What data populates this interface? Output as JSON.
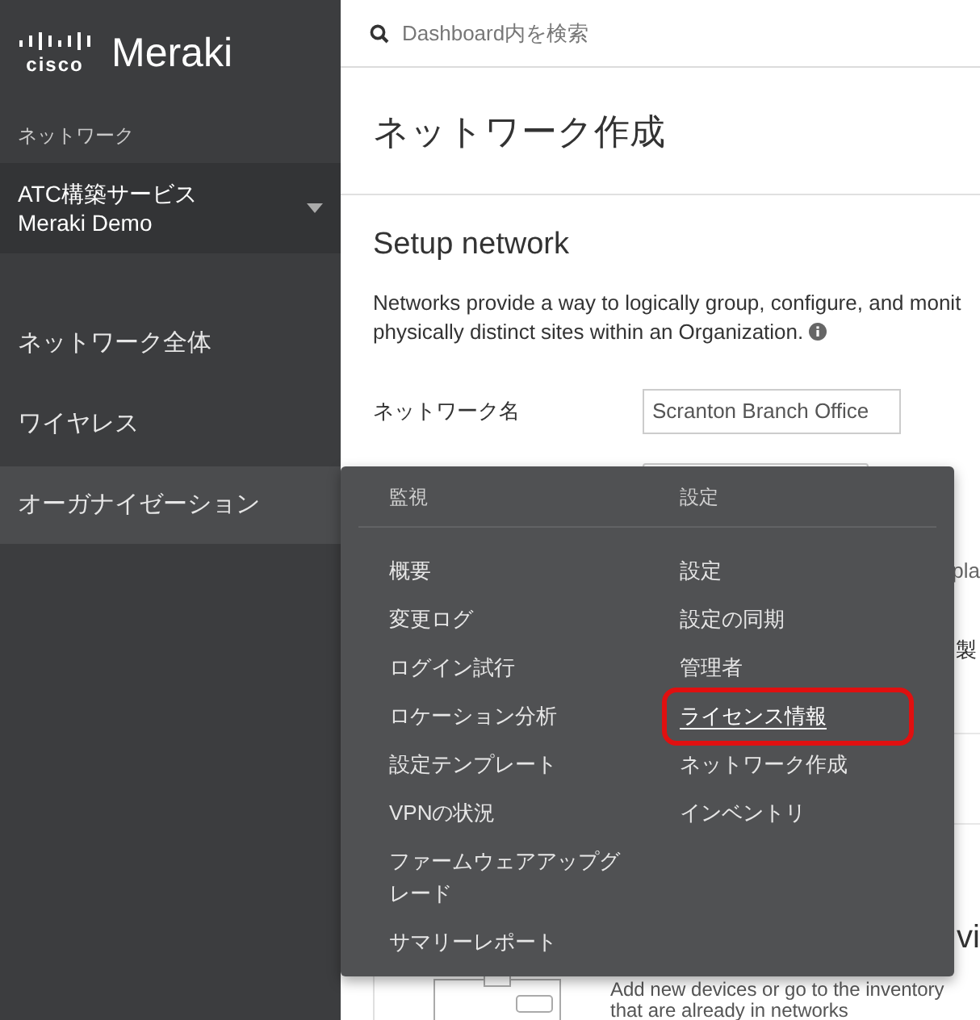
{
  "sidebar": {
    "logo": {
      "wordmark": "cisco",
      "product": "Meraki"
    },
    "section_label": "ネットワーク",
    "network_selector": {
      "line_1": "ATC構築サービス",
      "line_2": "Meraki Demo"
    },
    "items": [
      {
        "label": "ネットワーク全体",
        "selected": false
      },
      {
        "label": "ワイヤレス",
        "selected": false
      },
      {
        "label": "オーガナイゼーション",
        "selected": true
      }
    ]
  },
  "search": {
    "placeholder": "Dashboard内を検索"
  },
  "page_title": "ネットワーク作成",
  "setup": {
    "heading": "Setup network",
    "description": "Networks provide a way to logically group, configure, and monit physically distinct sites within an Organization.",
    "name_label": "ネットワーク名",
    "name_value": "Scranton Branch Office",
    "partial_text_1": "pla",
    "partial_text_2": "製"
  },
  "add_devices": {
    "heading_fragment": "vi",
    "line_1": "Add new devices or go to the inventory",
    "line_2": "that are already in networks"
  },
  "menu": {
    "columns": [
      {
        "heading": "監視",
        "items": [
          {
            "label": "概要",
            "highlighted": false
          },
          {
            "label": "変更ログ",
            "highlighted": false
          },
          {
            "label": "ログイン試行",
            "highlighted": false
          },
          {
            "label": "ロケーション分析",
            "highlighted": false
          },
          {
            "label": "設定テンプレート",
            "highlighted": false
          },
          {
            "label": "VPNの状況",
            "highlighted": false
          },
          {
            "label": "ファームウェアアップグレード",
            "highlighted": false
          },
          {
            "label": "サマリーレポート",
            "highlighted": false
          }
        ]
      },
      {
        "heading": "設定",
        "items": [
          {
            "label": "設定",
            "highlighted": false
          },
          {
            "label": "設定の同期",
            "highlighted": false
          },
          {
            "label": "管理者",
            "highlighted": false
          },
          {
            "label": "ライセンス情報",
            "highlighted": true
          },
          {
            "label": "ネットワーク作成",
            "highlighted": false
          },
          {
            "label": "インベントリ",
            "highlighted": false
          }
        ]
      }
    ]
  }
}
